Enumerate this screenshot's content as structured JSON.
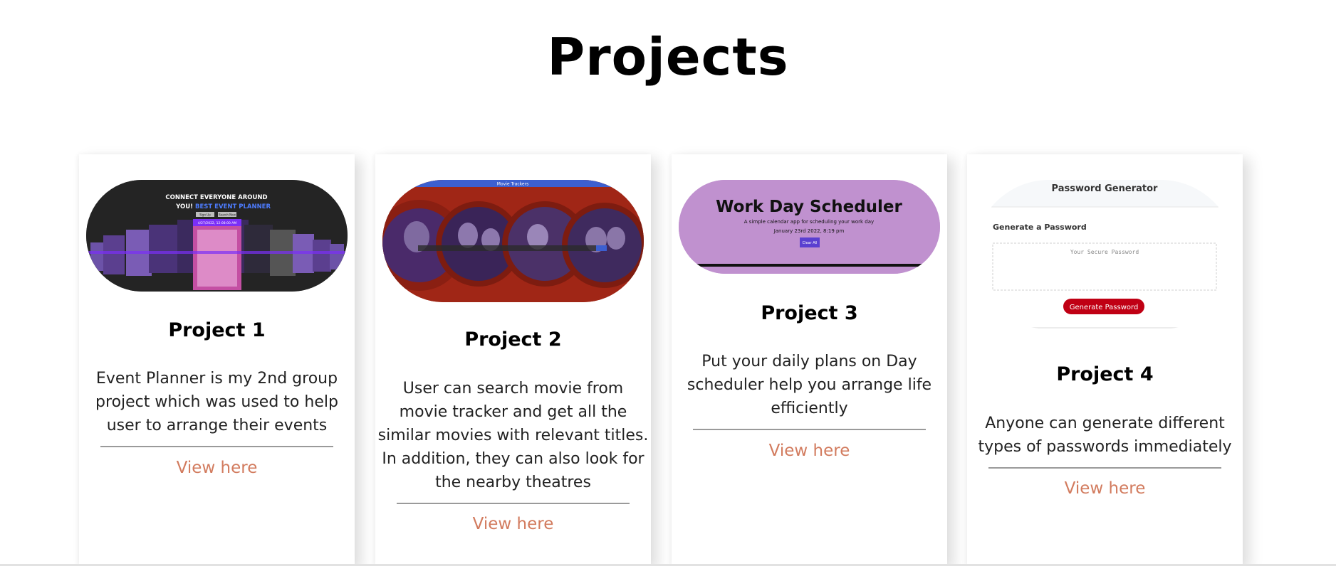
{
  "page": {
    "title": "Projects"
  },
  "projects": [
    {
      "title": "Project 1",
      "description": "Event Planner is my 2nd group project which was used to help user to arrange their events",
      "link": "View here",
      "preview": {
        "heading_line1": "CONNECT EVERYONE AROUND",
        "heading_line2a": "YOU!",
        "heading_line2b": "BEST EVENT PLANNER",
        "button1": "Sign Up",
        "button2": "Search Now",
        "date_label": "4/27/2022, 12:08:00 AM"
      }
    },
    {
      "title": "Project 2",
      "description": "User can search movie from movie tracker and get all the similar movies with relevant titles. In addition, they can also look for the nearby theatres",
      "link": "View here",
      "preview": {
        "banner": "Movie Trackers"
      }
    },
    {
      "title": "Project 3",
      "description": "Put your daily plans on Day scheduler help you arrange life efficiently",
      "link": "View here",
      "preview": {
        "heading": "Work Day Scheduler",
        "subtitle": "A simple calendar app for scheduling your work day",
        "date": "January 23rd 2022, 8:19 pm",
        "button": "Clear All"
      }
    },
    {
      "title": "Project 4",
      "description": "Anyone can generate different types of passwords immediately",
      "link": "View here",
      "preview": {
        "app_title": "Password Generator",
        "section_label": "Generate a Password",
        "placeholder": "Your Secure Password",
        "button": "Generate Password"
      }
    }
  ],
  "colors": {
    "link": "#d27b5e",
    "accent_purple": "#7b2ff7",
    "movie_red": "#a02616",
    "scheduler_lilac": "#c091cf",
    "password_red": "#c00014"
  }
}
